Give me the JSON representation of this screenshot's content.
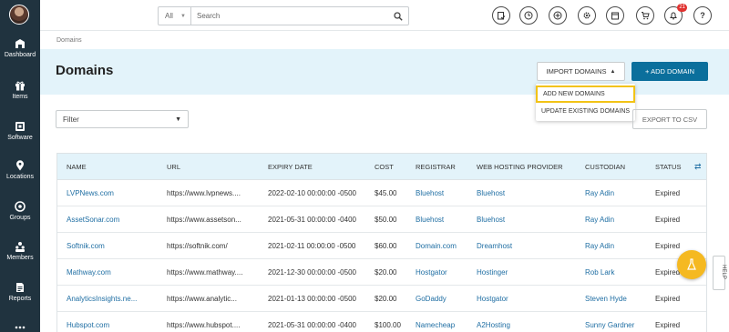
{
  "sidebar": {
    "items": [
      {
        "label": "Dashboard",
        "icon": "dashboard-icon"
      },
      {
        "label": "Items",
        "icon": "gift-icon"
      },
      {
        "label": "Software",
        "icon": "software-icon"
      },
      {
        "label": "Locations",
        "icon": "location-pin-icon"
      },
      {
        "label": "Groups",
        "icon": "groups-icon"
      },
      {
        "label": "Members",
        "icon": "members-icon"
      },
      {
        "label": "Reports",
        "icon": "reports-icon"
      }
    ]
  },
  "topbar": {
    "search_scope": "All",
    "search_placeholder": "Search",
    "notification_count": "21"
  },
  "breadcrumb": "Domains",
  "page_title": "Domains",
  "buttons": {
    "import": "IMPORT DOMAINS",
    "add": "+ ADD DOMAIN",
    "export": "EXPORT TO CSV"
  },
  "import_menu": {
    "items": [
      "ADD NEW DOMAINS",
      "UPDATE EXISTING DOMAINS"
    ]
  },
  "filter": {
    "value": "Filter"
  },
  "table": {
    "columns": [
      "NAME",
      "URL",
      "EXPIRY DATE",
      "COST",
      "REGISTRAR",
      "WEB HOSTING PROVIDER",
      "CUSTODIAN",
      "STATUS"
    ],
    "rows": [
      [
        "LVPNews.com",
        "https://www.lvpnews....",
        "2022-02-10 00:00:00 -0500",
        "$45.00",
        "Bluehost",
        "Bluehost",
        "Ray Adin",
        "Expired"
      ],
      [
        "AssetSonar.com",
        "https://www.assetson...",
        "2021-05-31 00:00:00 -0400",
        "$50.00",
        "Bluehost",
        "Bluehost",
        "Ray Adin",
        "Expired"
      ],
      [
        "Softnik.com",
        "https://softnik.com/",
        "2021-02-11 00:00:00 -0500",
        "$60.00",
        "Domain.com",
        "Dreamhost",
        "Ray Adin",
        "Expired"
      ],
      [
        "Mathway.com",
        "https://www.mathway....",
        "2021-12-30 00:00:00 -0500",
        "$20.00",
        "Hostgator",
        "Hostinger",
        "Rob Lark",
        "Expired"
      ],
      [
        "AnalyticsInsights.ne...",
        "https://www.analytic...",
        "2021-01-13 00:00:00 -0500",
        "$20.00",
        "GoDaddy",
        "Hostgator",
        "Steven Hyde",
        "Expired"
      ],
      [
        "Hubspot.com",
        "https://www.hubspot....",
        "2021-05-31 00:00:00 -0400",
        "$100.00",
        "Namecheap",
        "A2Hosting",
        "Sunny Gardner",
        "Expired"
      ]
    ]
  },
  "help_tab": "HELP",
  "colors": {
    "sidebar_bg": "#20333f",
    "primary": "#0b6f9c",
    "link": "#1f6ea3",
    "header_band": "#e3f3fa",
    "highlight": "#f2c316",
    "fab": "#f5b921"
  }
}
